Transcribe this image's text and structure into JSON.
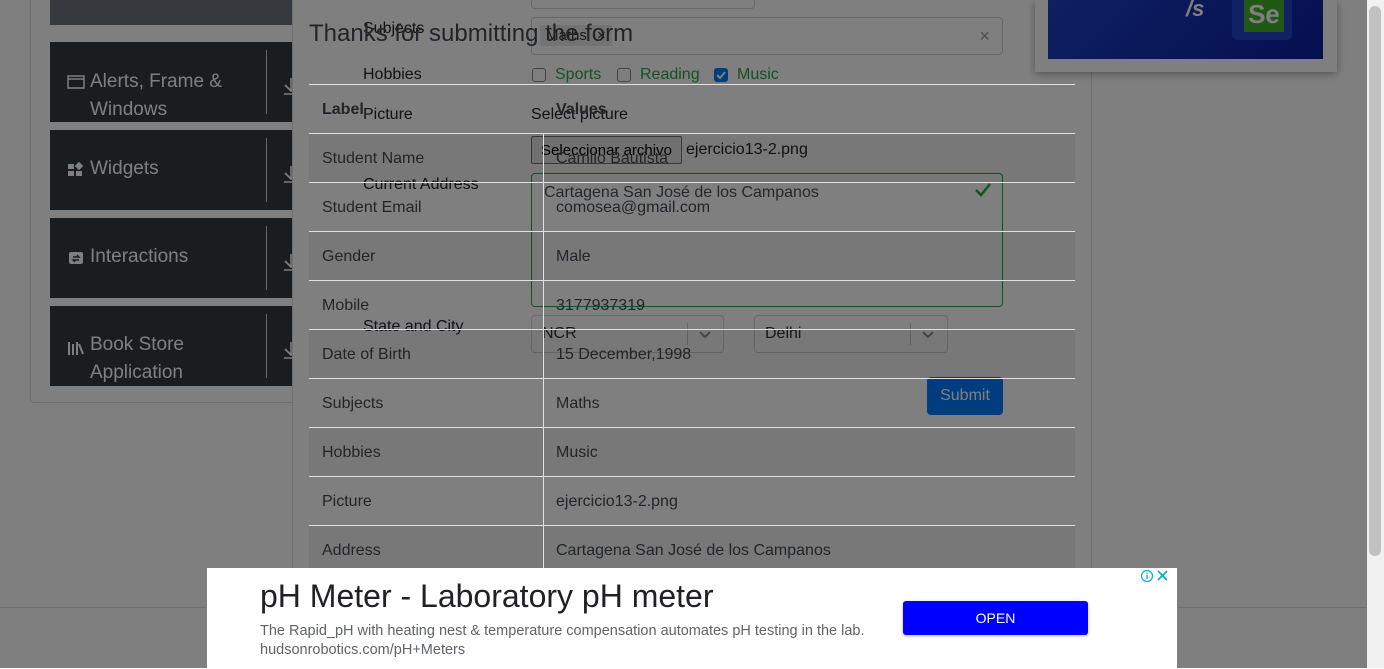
{
  "sidebar": {
    "groups": [
      {
        "label_line1": "Alerts, Frame &",
        "label_line2": "Windows",
        "icon": "window-icon"
      },
      {
        "label_line1": "Widgets",
        "label_line2": "",
        "icon": "widgets-icon"
      },
      {
        "label_line1": "Interactions",
        "label_line2": "",
        "icon": "interactions-icon"
      },
      {
        "label_line1": "Book Store",
        "label_line2": "Application",
        "icon": "books-icon"
      }
    ]
  },
  "form": {
    "subjects_label": "Subjects",
    "subjects_tag": "Maths",
    "hobbies_label": "Hobbies",
    "hobbies": [
      {
        "label": "Sports",
        "checked": false
      },
      {
        "label": "Reading",
        "checked": false
      },
      {
        "label": "Music",
        "checked": true
      }
    ],
    "picture_label": "Picture",
    "picture_prompt": "Select picture",
    "file_button": "Seleccionar archivo",
    "file_name": "ejercicio13-2.png",
    "address_label": "Current Address",
    "address_value": "Cartagena San José de los Campanos",
    "state_city_label": "State and City",
    "state_value": "NCR",
    "city_value": "Delhi",
    "submit_label": "Submit"
  },
  "modal": {
    "title": "Thanks for submitting the form",
    "header": {
      "label": "Label",
      "values": "Values"
    },
    "rows": [
      {
        "label": "Student Name",
        "value": "Camilo Bautista"
      },
      {
        "label": "Student Email",
        "value": "comosea@gmail.com"
      },
      {
        "label": "Gender",
        "value": "Male"
      },
      {
        "label": "Mobile",
        "value": "3177937319"
      },
      {
        "label": "Date of Birth",
        "value": "15 December,1998"
      },
      {
        "label": "Subjects",
        "value": "Maths"
      },
      {
        "label": "Hobbies",
        "value": "Music"
      },
      {
        "label": "Picture",
        "value": "ejercicio13-2.png"
      },
      {
        "label": "Address",
        "value": "Cartagena San José de los Campanos"
      }
    ]
  },
  "ad": {
    "title": "pH Meter - Laboratory pH meter",
    "description": "The Rapid_pH with heating nest & temperature compensation automates pH testing in the lab. hudsonrobotics.com/pH+Meters",
    "button": "OPEN"
  },
  "colors": {
    "sidebar_bg": "#343a40",
    "accent": "#007bff",
    "success": "#28a745",
    "ad_button": "#0000ff"
  }
}
